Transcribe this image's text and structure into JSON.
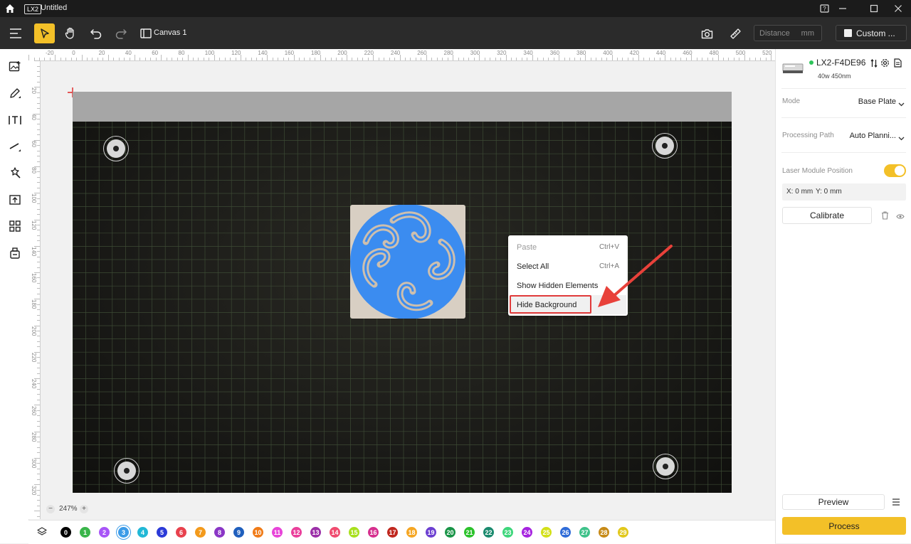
{
  "titlebar": {
    "badge": "LX2",
    "title": "Untitled"
  },
  "toolbar": {
    "canvas_label": "Canvas 1",
    "distance_placeholder": "Distance",
    "distance_unit": "mm",
    "custom_label": "Custom ..."
  },
  "ruler": {
    "h_labels": [
      "-20",
      "0",
      "20",
      "40",
      "60",
      "80",
      "100",
      "120",
      "140",
      "160",
      "180",
      "200",
      "220",
      "240",
      "260",
      "280",
      "300",
      "320",
      "340",
      "360",
      "380",
      "400",
      "420",
      "440",
      "460",
      "480",
      "500",
      "520"
    ],
    "v_labels": [
      "20",
      "40",
      "60",
      "80",
      "100",
      "120",
      "140",
      "160",
      "180",
      "200",
      "220",
      "240",
      "260",
      "280",
      "300",
      "320"
    ]
  },
  "context_menu": {
    "items": [
      {
        "label": "Paste",
        "shortcut": "Ctrl+V",
        "disabled": true
      },
      {
        "label": "Select All",
        "shortcut": "Ctrl+A",
        "disabled": false
      },
      {
        "label": "Show Hidden Elements",
        "shortcut": "",
        "disabled": false
      },
      {
        "label": "Hide Background",
        "shortcut": "",
        "disabled": false
      }
    ]
  },
  "zoom": {
    "value": "247%",
    "minus": "−",
    "plus": "+"
  },
  "layers": {
    "numbers": [
      "0",
      "1",
      "2",
      "3",
      "4",
      "5",
      "6",
      "7",
      "8",
      "9",
      "10",
      "11",
      "12",
      "13",
      "14",
      "15",
      "16",
      "17",
      "18",
      "19",
      "20",
      "21",
      "22",
      "23",
      "24",
      "25",
      "26",
      "27",
      "28",
      "29"
    ],
    "colors": [
      "#000000",
      "#3ab54a",
      "#a855f7",
      "#3b9be8",
      "#21b8d6",
      "#2b3ad8",
      "#e8414d",
      "#f39a1c",
      "#8a36c6",
      "#1f5fbd",
      "#f07b17",
      "#e844d9",
      "#ea3f9b",
      "#9b2fa8",
      "#f04b6f",
      "#a8e01d",
      "#d62f8e",
      "#c0271e",
      "#f5a623",
      "#6c3fd1",
      "#199447",
      "#2bc22b",
      "#1a8a6e",
      "#3ed67b",
      "#a623e0",
      "#d3e018",
      "#2f6cd8",
      "#3fc28a",
      "#c78a17",
      "#e2c81b"
    ]
  },
  "panel": {
    "device_name": "LX2-F4DE96",
    "device_spec": "40w 450nm",
    "mode_label": "Mode",
    "mode_value": "Base Plate",
    "path_label": "Processing Path",
    "path_value": "Auto Planni...",
    "laser_label": "Laser Module Position",
    "coord_x": "X: 0 mm",
    "coord_y": "Y: 0 mm",
    "calibrate": "Calibrate",
    "preview": "Preview",
    "process": "Process"
  },
  "colors": {
    "accent": "#f3c028",
    "logo_blue": "#3b8cf0",
    "highlight_red": "#e03a3a"
  }
}
